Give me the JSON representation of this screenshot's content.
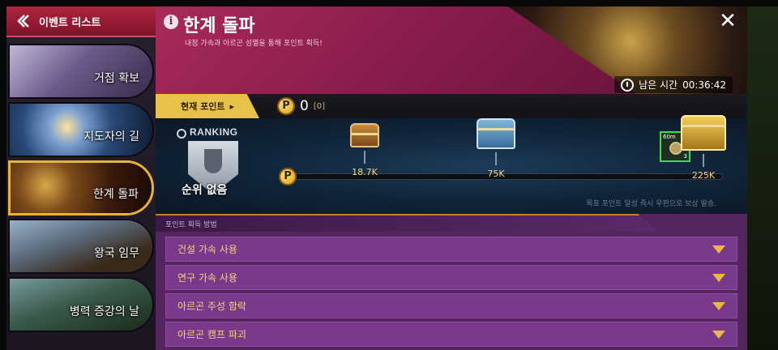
{
  "sidebar": {
    "back_label": "이벤트 리스트",
    "items": [
      {
        "label": "거점 확보",
        "color": "#6a5a8a"
      },
      {
        "label": "지도자의 길",
        "color": "#2a4a78"
      },
      {
        "label": "한계 돌파",
        "color": "#5a3a1a",
        "active": true
      },
      {
        "label": "왕국 임무",
        "color": "#3a4a5a"
      },
      {
        "label": "병력 증강의 날",
        "color": "#2a4a3a"
      }
    ]
  },
  "header": {
    "info_glyph": "i",
    "title": "한계 돌파",
    "subtitle": "내정 가속과 아르곤 섬멸을 통해 포인트 획득!",
    "close_glyph": "✕",
    "timer_label": "남은 시간",
    "timer_value": "00:36:42"
  },
  "points": {
    "tab_label": "현재 포인트",
    "tab_arrow": "▸",
    "coin_glyph": "P",
    "value": "0",
    "sub": "[0]"
  },
  "ranking": {
    "label": "RANKING",
    "status": "순위 없음"
  },
  "track": {
    "milestones": [
      {
        "value": "18.7K",
        "points": 18700
      },
      {
        "value": "75K",
        "points": 75000
      },
      {
        "value": "225K",
        "points": 225000
      }
    ],
    "bonus_item": {
      "label": "60m",
      "count": "3"
    },
    "note": "목표 포인트 달성 즉시 우편으로 보상 발송."
  },
  "section": {
    "header": "포인트 획득 방법",
    "rows": [
      {
        "label": "건설 가속 사용"
      },
      {
        "label": "연구 가속 사용"
      },
      {
        "label": "아르곤 주성 함락"
      },
      {
        "label": "아르곤 캠프 파괴"
      }
    ]
  }
}
